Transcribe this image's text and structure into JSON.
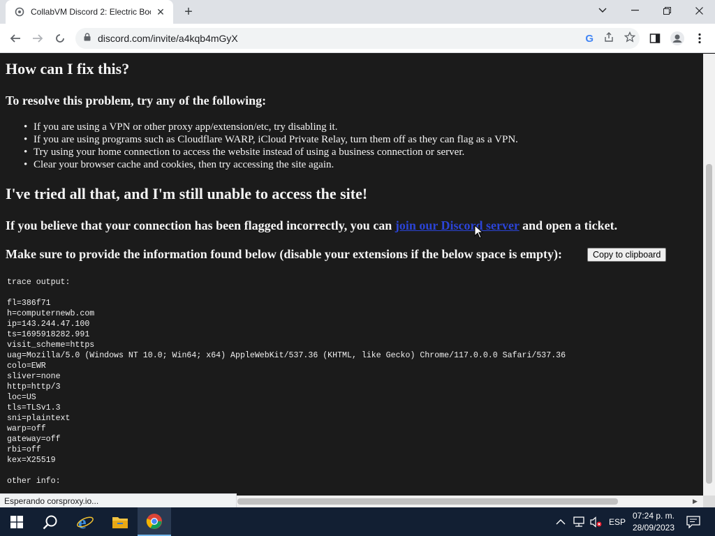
{
  "browser": {
    "tab_title": "CollabVM Discord 2: Electric Boo",
    "url": "discord.com/invite/a4kqb4mGyX",
    "status_text": "Esperando corsproxy.io..."
  },
  "page": {
    "heading": "How can I fix this?",
    "resolve_heading": "To resolve this problem, try any of the following:",
    "tips": [
      "If you are using a VPN or other proxy app/extension/etc, try disabling it.",
      "If you are using programs such as Cloudflare WARP, iCloud Private Relay, turn them off as they can flag as a VPN.",
      "Try using your home connection to access the website instead of using a business connection or server.",
      "Clear your browser cache and cookies, then try accessing the site again."
    ],
    "still_unable_heading": "I've tried all that, and I'm still unable to access the site!",
    "flagged_prefix": "If you believe that your connection has been flagged incorrectly, you can ",
    "flagged_link": "join our Discord server",
    "flagged_suffix": " and open a ticket.",
    "provide_info": "Make sure to provide the information found below (disable your extensions if the below space is empty):",
    "copy_button": "Copy to clipboard",
    "trace_output": "trace output:\n\nfl=386f71\nh=computernewb.com\nip=143.244.47.100\nts=1695918282.991\nvisit_scheme=https\nuag=Mozilla/5.0 (Windows NT 10.0; Win64; x64) AppleWebKit/537.36 (KHTML, like Gecko) Chrome/117.0.0.0 Safari/537.36\ncolo=EWR\nsliver=none\nhttp=http/3\nloc=US\ntls=TLSv1.3\nsni=plaintext\nwarp=off\ngateway=off\nrbi=off\nkex=X25519\n\nother info:"
  },
  "taskbar": {
    "language": "ESP",
    "time": "07:24 p. m.",
    "date": "28/09/2023"
  },
  "icons": [
    "windows-start-icon",
    "search-icon",
    "internet-explorer-icon",
    "file-explorer-icon",
    "chrome-icon"
  ],
  "colors": {
    "page_bg": "#1b1b1b",
    "link": "#2b44d6",
    "taskbar": "#121f33"
  }
}
